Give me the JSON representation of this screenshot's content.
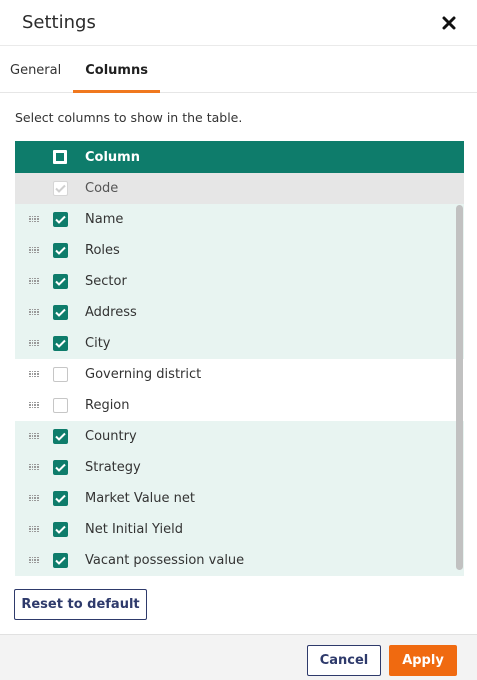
{
  "dialog": {
    "title": "Settings",
    "close_icon": "close-icon"
  },
  "tabs": [
    {
      "label": "General",
      "active": false
    },
    {
      "label": "Columns",
      "active": true
    }
  ],
  "description": "Select columns to show in the table.",
  "table": {
    "header": "Column",
    "fixed_row": {
      "label": "Code",
      "checked": true,
      "disabled": true
    },
    "rows": [
      {
        "label": "Name",
        "checked": true
      },
      {
        "label": "Roles",
        "checked": true
      },
      {
        "label": "Sector",
        "checked": true
      },
      {
        "label": "Address",
        "checked": true
      },
      {
        "label": "City",
        "checked": true
      },
      {
        "label": "Governing district",
        "checked": false
      },
      {
        "label": "Region",
        "checked": false
      },
      {
        "label": "Country",
        "checked": true
      },
      {
        "label": "Strategy",
        "checked": true
      },
      {
        "label": "Market Value net",
        "checked": true
      },
      {
        "label": "Net Initial Yield",
        "checked": true
      },
      {
        "label": "Vacant possession value",
        "checked": true
      }
    ]
  },
  "buttons": {
    "reset": "Reset to default",
    "cancel": "Cancel",
    "apply": "Apply"
  },
  "colors": {
    "primary": "#0e7c6b",
    "accent": "#f06a10",
    "row_selected": "#e8f4f1",
    "outline_button": "#2e3a6b"
  }
}
